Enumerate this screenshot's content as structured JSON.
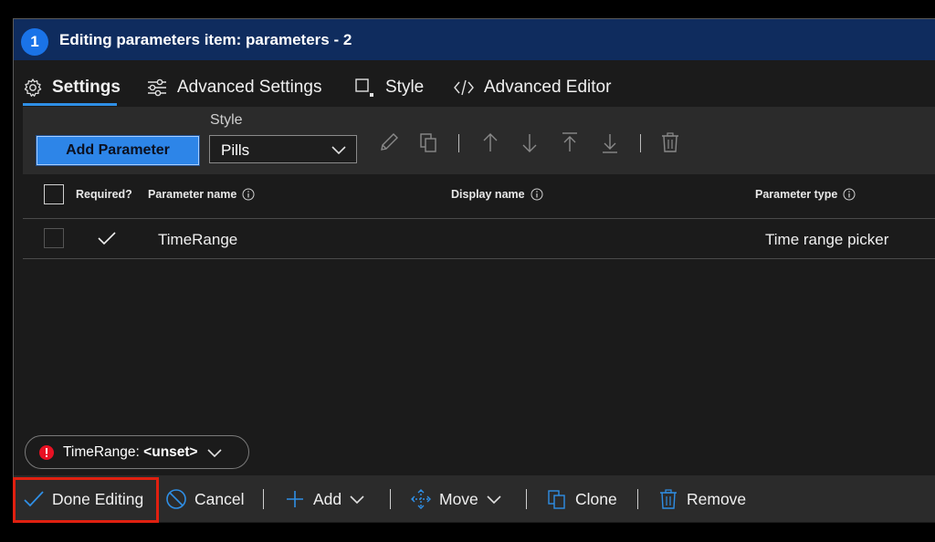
{
  "title_bar": {
    "step": "1",
    "title": "Editing parameters item: parameters - 2"
  },
  "tabs": [
    {
      "label": "Settings",
      "icon": "gear-icon",
      "active": true
    },
    {
      "label": "Advanced Settings",
      "icon": "sliders-icon",
      "active": false
    },
    {
      "label": "Style",
      "icon": "style-icon",
      "active": false
    },
    {
      "label": "Advanced Editor",
      "icon": "code-icon",
      "active": false
    }
  ],
  "toolbar": {
    "add_parameter_label": "Add Parameter",
    "style_label": "Style",
    "style_value": "Pills",
    "icons": [
      "pencil-icon",
      "copy-icon",
      "arrow-up-icon",
      "arrow-down-icon",
      "move-to-top-icon",
      "move-to-bottom-icon",
      "trash-icon"
    ]
  },
  "table": {
    "headers": {
      "required": "Required?",
      "name": "Parameter name",
      "display": "Display name",
      "type": "Parameter type"
    },
    "rows": [
      {
        "required": true,
        "name": "TimeRange",
        "display": "",
        "type": "Time range picker"
      }
    ]
  },
  "preview": {
    "name": "TimeRange:",
    "value": "<unset>"
  },
  "bottom_bar": {
    "done": "Done Editing",
    "cancel": "Cancel",
    "add": "Add",
    "move": "Move",
    "clone": "Clone",
    "remove": "Remove"
  },
  "colors": {
    "accent": "#2d85e8",
    "title_bar": "#0f2c5e",
    "highlight": "#e02010",
    "error": "#e81123"
  }
}
